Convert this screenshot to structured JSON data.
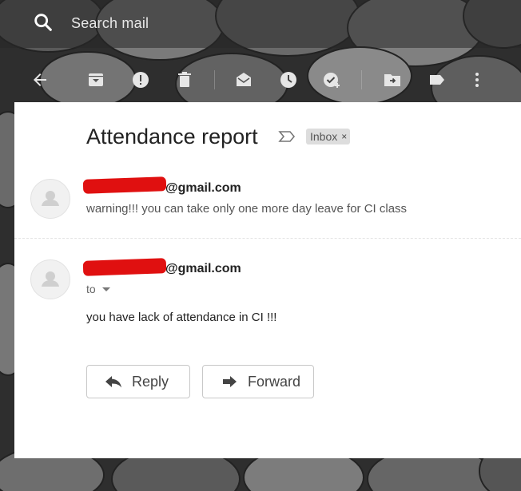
{
  "search": {
    "placeholder": "Search mail"
  },
  "toolbar": {
    "icons": [
      "back-arrow-icon",
      "archive-icon",
      "report-spam-icon",
      "delete-icon",
      "mark-unread-icon",
      "snooze-icon",
      "add-to-tasks-icon",
      "move-to-icon",
      "label-icon",
      "more-vert-icon"
    ]
  },
  "email": {
    "subject": "Attendance report",
    "label_chip": "Inbox",
    "chip_close": "×",
    "messages": [
      {
        "sender_suffix": "@gmail.com",
        "snippet": "warning!!! you can take only one more day leave for CI class"
      },
      {
        "sender_suffix": "@gmail.com",
        "to_label": "to",
        "body": "you have lack of attendance in CI !!!"
      }
    ]
  },
  "actions": {
    "reply": "Reply",
    "forward": "Forward"
  },
  "colors": {
    "redaction": "#e01010",
    "card": "#ffffff",
    "chip": "#dddddd"
  }
}
